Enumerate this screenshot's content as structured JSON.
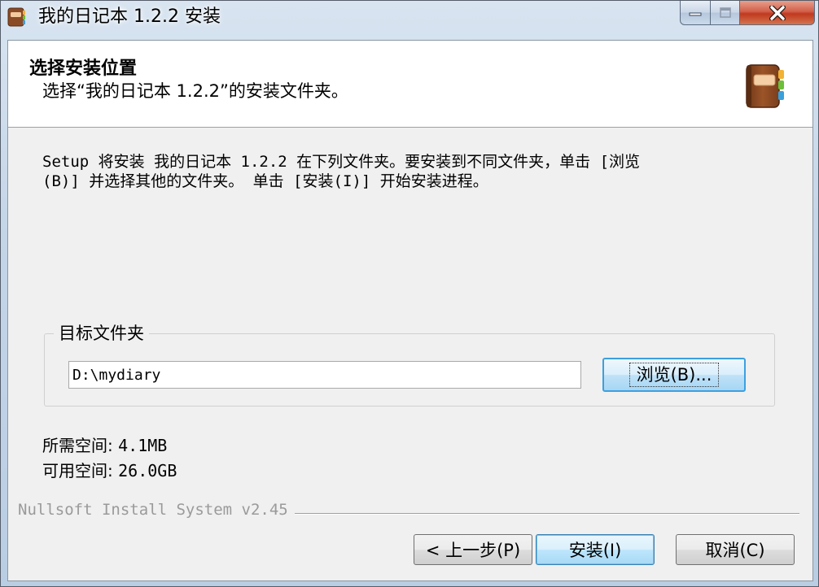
{
  "window": {
    "title": "我的日记本 1.2.2 安装"
  },
  "header": {
    "title": "选择安装位置",
    "subtitle": "选择“我的日记本 1.2.2”的安装文件夹。"
  },
  "description": {
    "line1": "Setup 将安装 我的日记本 1.2.2 在下列文件夹。要安装到不同文件夹，单击 [浏览",
    "line2": "(B)] 并选择其他的文件夹。 单击 [安装(I)] 开始安装进程。"
  },
  "destination": {
    "group_label": "目标文件夹",
    "path_value": "D:\\mydiary",
    "browse_label": "浏览(B)..."
  },
  "space": {
    "required_label": "所需空间: ",
    "required_value": "4.1MB",
    "available_label": "可用空间: ",
    "available_value": "26.0GB"
  },
  "branding": "Nullsoft Install System v2.45",
  "buttons": {
    "back": "< 上一步(P)",
    "install": "安装(I)",
    "cancel": "取消(C)"
  },
  "icons": {
    "app": "diary-book-icon",
    "header": "diary-book-icon",
    "minimize": "minimize-icon",
    "maximize": "maximize-icon",
    "close": "close-icon"
  },
  "colors": {
    "accent": "#3ca0e0",
    "book_brown": "#8b4a26",
    "close_red": "#c0391f"
  }
}
